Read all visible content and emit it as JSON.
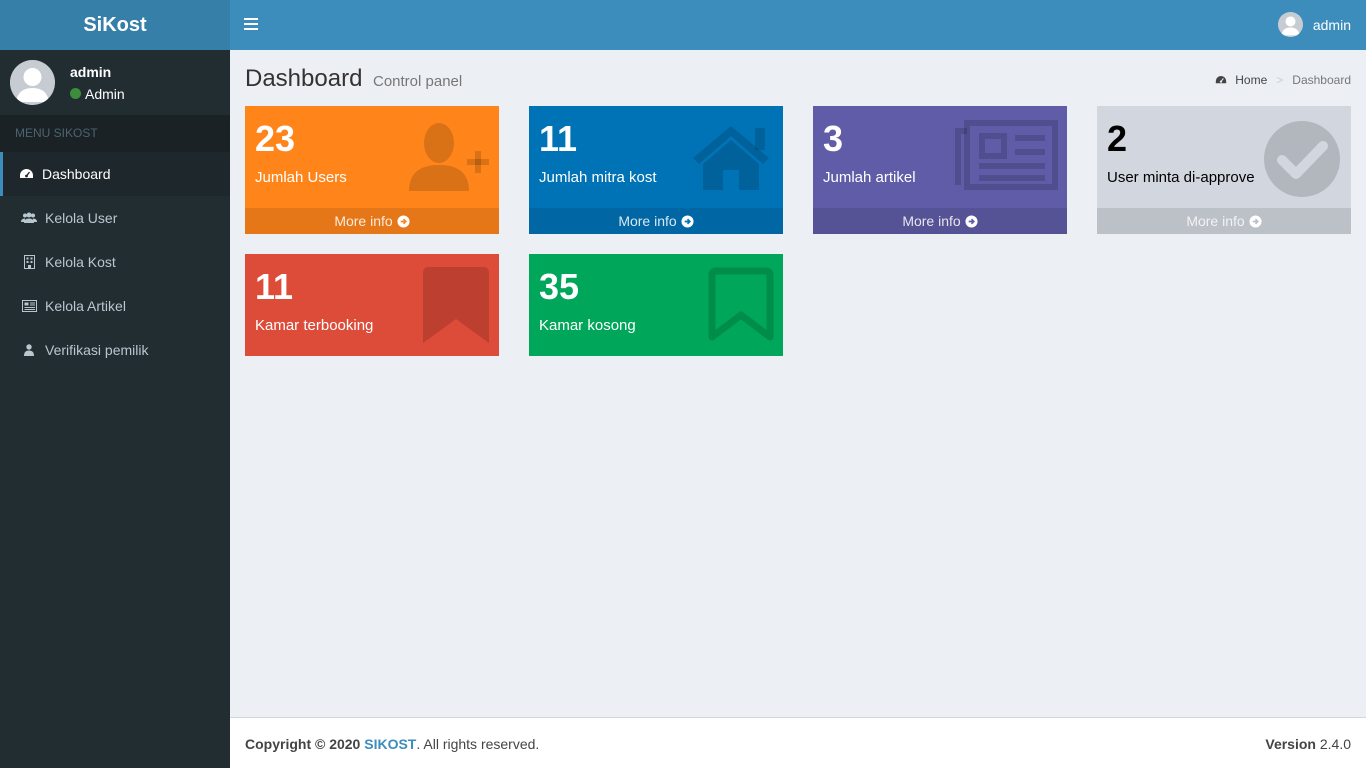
{
  "app": {
    "title": "SiKost"
  },
  "user": {
    "name": "admin",
    "role": "Admin",
    "status_color": "#3c8d3c"
  },
  "sidebar": {
    "header": "MENU SIKOST",
    "items": [
      {
        "label": "Dashboard",
        "icon": "dashboard-icon",
        "active": true
      },
      {
        "label": "Kelola User",
        "icon": "users-icon"
      },
      {
        "label": "Kelola Kost",
        "icon": "building-icon"
      },
      {
        "label": "Kelola Artikel",
        "icon": "newspaper-icon"
      },
      {
        "label": "Verifikasi pemilik",
        "icon": "user-icon"
      }
    ]
  },
  "topbar": {
    "user_name": "admin"
  },
  "page": {
    "title": "Dashboard",
    "subtitle": "Control panel",
    "breadcrumb": {
      "home": "Home",
      "current": "Dashboard"
    }
  },
  "boxes": [
    {
      "value": "23",
      "label": "Jumlah Users",
      "more": "More info",
      "color": "#ff851b",
      "icon": "user-plus-icon"
    },
    {
      "value": "11",
      "label": "Jumlah mitra kost",
      "more": "More info",
      "color": "#0073b7",
      "icon": "home-icon"
    },
    {
      "value": "3",
      "label": "Jumlah artikel",
      "more": "More info",
      "color": "#605ca8",
      "icon": "newspaper-icon"
    },
    {
      "value": "2",
      "label": "User minta di-approve",
      "more": "More info",
      "color": "#d2d6de",
      "icon": "check-circle-icon"
    },
    {
      "value": "11",
      "label": "Kamar terbooking",
      "color": "#dd4b39",
      "icon": "bookmark-icon"
    },
    {
      "value": "35",
      "label": "Kamar kosong",
      "color": "#00a65a",
      "icon": "bookmark-outline-icon"
    }
  ],
  "footer": {
    "copyright": "Copyright © 2020",
    "brand": "SIKOST",
    "rights": ". All rights reserved.",
    "version_label": "Version",
    "version": "2.4.0"
  }
}
